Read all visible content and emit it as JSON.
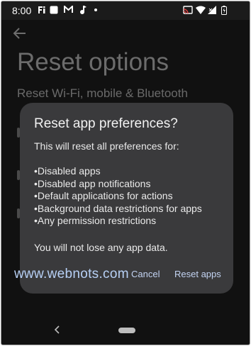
{
  "status_bar": {
    "time": "8:00",
    "left_icons": [
      "fi-app-icon",
      "square-app-icon",
      "gmail-icon",
      "music-icon",
      "dot-icon"
    ],
    "right_icons": [
      "cast-icon",
      "wifi-icon",
      "signal-icon",
      "battery-icon"
    ]
  },
  "background_page": {
    "title": "Reset options",
    "subtitle": "Reset Wi-Fi, mobile & Bluetooth"
  },
  "dialog": {
    "title": "Reset app preferences?",
    "intro": "This will reset all preferences for:",
    "items": [
      "Disabled apps",
      "Disabled app notifications",
      "Default applications for actions",
      "Background data restrictions for apps",
      "Any permission restrictions"
    ],
    "note": "You will not lose any app data.",
    "cancel_label": "Cancel",
    "reset_label": "Reset apps"
  },
  "watermark": "www.webnots.com",
  "colors": {
    "background": "#111111",
    "dialog": "#3a3a3c",
    "button_text": "#c3d3f2",
    "watermark": "#b7d0f5"
  }
}
